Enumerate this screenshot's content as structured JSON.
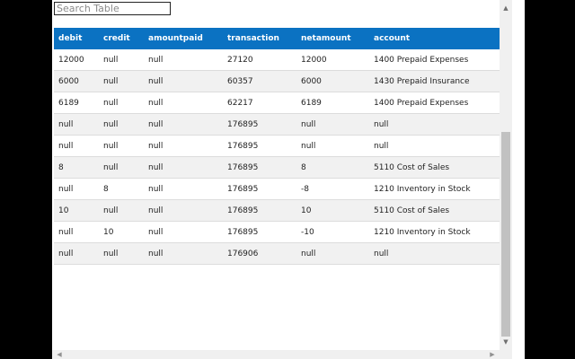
{
  "search": {
    "placeholder": "Search Table"
  },
  "table": {
    "columns": [
      "debit",
      "credit",
      "amountpaid",
      "transaction",
      "netamount",
      "account"
    ],
    "rows": [
      [
        "12000",
        "null",
        "null",
        "27120",
        "12000",
        "1400 Prepaid Expenses"
      ],
      [
        "6000",
        "null",
        "null",
        "60357",
        "6000",
        "1430 Prepaid Insurance"
      ],
      [
        "6189",
        "null",
        "null",
        "62217",
        "6189",
        "1400 Prepaid Expenses"
      ],
      [
        "null",
        "null",
        "null",
        "176895",
        "null",
        "null"
      ],
      [
        "null",
        "null",
        "null",
        "176895",
        "null",
        "null"
      ],
      [
        "8",
        "null",
        "null",
        "176895",
        "8",
        "5110 Cost of Sales"
      ],
      [
        "null",
        "8",
        "null",
        "176895",
        "-8",
        "1210 Inventory in Stock"
      ],
      [
        "10",
        "null",
        "null",
        "176895",
        "10",
        "5110 Cost of Sales"
      ],
      [
        "null",
        "10",
        "null",
        "176895",
        "-10",
        "1210 Inventory in Stock"
      ],
      [
        "null",
        "null",
        "null",
        "176906",
        "null",
        "null"
      ]
    ]
  },
  "colors": {
    "header_bg": "#0b72c2",
    "header_text": "#ffffff",
    "row_alt": "#f1f1f1"
  },
  "icons": {
    "scroll_up": "triangle-up-icon",
    "scroll_down": "triangle-down-icon",
    "scroll_left": "triangle-left-icon",
    "scroll_right": "triangle-right-icon"
  }
}
